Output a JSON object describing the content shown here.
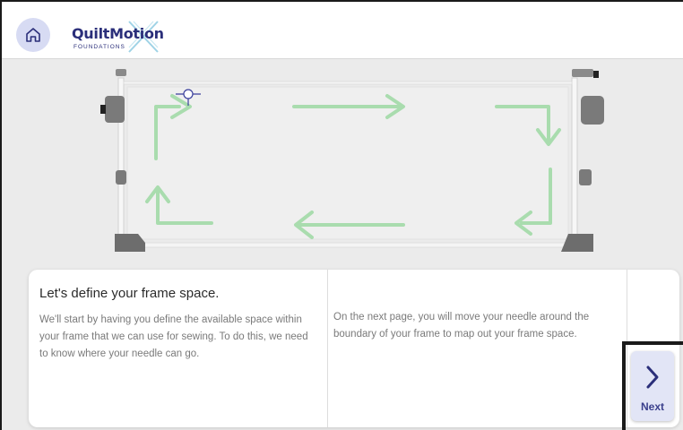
{
  "header": {
    "home_icon": "home-icon",
    "logo": {
      "name": "QuiltMotion",
      "subtitle": "FOUNDATIONS",
      "mark": "X"
    }
  },
  "frame_diagram": {
    "arrow_color": "#a9dcae",
    "needle_icon": "needle-crosshair-icon"
  },
  "info": {
    "title": "Let's define your frame space.",
    "paragraph1": "We'll start by having you define the available space within your frame that we can use for sewing. To do this, we need to know where your needle can go.",
    "paragraph2": "On the next page, you will move your needle around the boundary of your frame to map out your frame space."
  },
  "nav": {
    "next_label": "Next",
    "next_icon": "chevron-right-icon"
  },
  "colors": {
    "accent": "#2b2f7a",
    "home_bg": "#d7dbf3",
    "next_bg": "#e2e5f6"
  }
}
